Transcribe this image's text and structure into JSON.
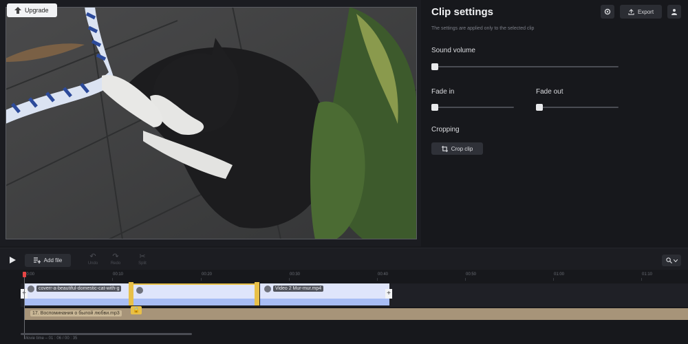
{
  "preview": {
    "upgrade_label": "Upgrade"
  },
  "panel": {
    "title": "Clip settings",
    "export_label": "Export",
    "subtitle": "The settings are applied only to the selected clip",
    "sound_volume_label": "Sound volume",
    "sound_volume_value": 0,
    "fade_in_label": "Fade in",
    "fade_in_value": 0,
    "fade_out_label": "Fade out",
    "fade_out_value": 0,
    "cropping_label": "Cropping",
    "crop_button_label": "Crop clip"
  },
  "toolbar": {
    "add_file_label": "Add file",
    "undo_label": "Undo",
    "redo_label": "Redo",
    "split_label": "Split"
  },
  "timeline": {
    "ticks": [
      "00:00",
      "00:10",
      "00:20",
      "00:30",
      "00:40",
      "00:50",
      "01:00",
      "01:10"
    ],
    "clips": [
      {
        "name": "coverr-a-beautiful-domestic-cat-with-g",
        "selected": false
      },
      {
        "name": "",
        "selected": true
      },
      {
        "name": "Video 2 Mur-mur.mp4",
        "selected": false
      }
    ],
    "audio_name": "17. Воспоминания о былой любви.mp3",
    "movie_time": "Movie time – 01 : 06 / 00 : 35"
  },
  "colors": {
    "accent_yellow": "#e8c048",
    "clip_blue": "#a8bdf4",
    "audio_tan": "#a79479",
    "playhead_red": "#e64545"
  }
}
